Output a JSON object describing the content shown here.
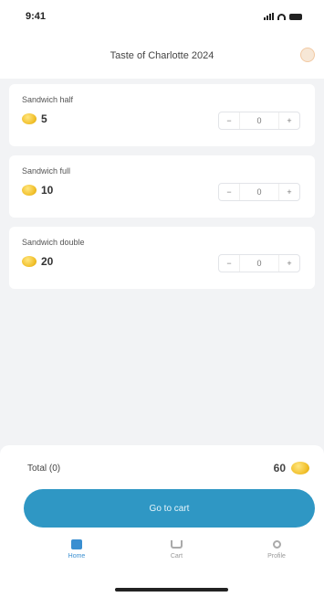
{
  "status_bar": {
    "time": "9:41"
  },
  "header": {
    "title": "Taste of Charlotte 2024"
  },
  "items": [
    {
      "name": "Sandwich half",
      "price": "5",
      "quantity": "0",
      "minus": "−",
      "plus": "+"
    },
    {
      "name": "Sandwich full",
      "price": "10",
      "quantity": "0",
      "minus": "−",
      "plus": "+"
    },
    {
      "name": "Sandwich double",
      "price": "20",
      "quantity": "0",
      "minus": "−",
      "plus": "+"
    }
  ],
  "summary": {
    "total_label": "Total (0)",
    "total_value": "60"
  },
  "cta": {
    "label": "Go to cart"
  },
  "tabs": [
    {
      "label": "Home",
      "icon": "home-icon",
      "active": true
    },
    {
      "label": "Cart",
      "icon": "cart-icon",
      "active": false
    },
    {
      "label": "Profile",
      "icon": "profile-icon",
      "active": false
    }
  ],
  "colors": {
    "accent": "#2f97c4",
    "tab_active": "#3a8fd1",
    "coin": "#f2c230"
  }
}
